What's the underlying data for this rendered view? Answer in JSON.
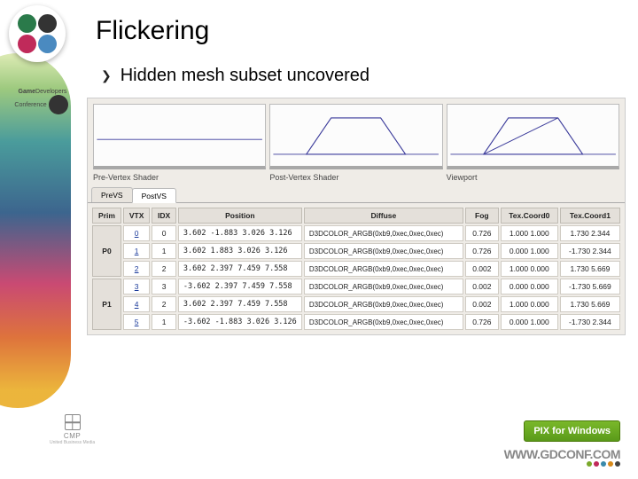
{
  "title": "Flickering",
  "bullet": "Hidden mesh subset uncovered",
  "viewports": [
    {
      "label": "Pre-Vertex Shader"
    },
    {
      "label": "Post-Vertex Shader"
    },
    {
      "label": "Viewport"
    }
  ],
  "tabs": [
    {
      "label": "PreVS",
      "active": false
    },
    {
      "label": "PostVS",
      "active": true
    }
  ],
  "columns": [
    "Prim",
    "VTX",
    "IDX",
    "Position",
    "Diffuse",
    "Fog",
    "Tex.Coord0",
    "Tex.Coord1"
  ],
  "prims": [
    {
      "name": "P0",
      "rows": [
        {
          "vtx": "0",
          "idx": "0",
          "pos": "3.602 -1.883 3.026 3.126",
          "diffuse": "D3DCOLOR_ARGB(0xb9,0xec,0xec,0xec)",
          "fog": "0.726",
          "tc0": "1.000 1.000",
          "tc1": "1.730 2.344"
        },
        {
          "vtx": "1",
          "idx": "1",
          "pos": "3.602 1.883 3.026 3.126",
          "diffuse": "D3DCOLOR_ARGB(0xb9,0xec,0xec,0xec)",
          "fog": "0.726",
          "tc0": "0.000 1.000",
          "tc1": "-1.730 2.344"
        },
        {
          "vtx": "2",
          "idx": "2",
          "pos": "3.602 2.397 7.459 7.558",
          "diffuse": "D3DCOLOR_ARGB(0xb9,0xec,0xec,0xec)",
          "fog": "0.002",
          "tc0": "1.000 0.000",
          "tc1": "1.730 5.669"
        }
      ]
    },
    {
      "name": "P1",
      "rows": [
        {
          "vtx": "3",
          "idx": "3",
          "pos": "-3.602 2.397 7.459 7.558",
          "diffuse": "D3DCOLOR_ARGB(0xb9,0xec,0xec,0xec)",
          "fog": "0.002",
          "tc0": "0.000 0.000",
          "tc1": "-1.730 5.669"
        },
        {
          "vtx": "4",
          "idx": "2",
          "pos": "3.602 2.397 7.459 7.558",
          "diffuse": "D3DCOLOR_ARGB(0xb9,0xec,0xec,0xec)",
          "fog": "0.002",
          "tc0": "1.000 0.000",
          "tc1": "1.730 5.669"
        },
        {
          "vtx": "5",
          "idx": "1",
          "pos": "-3.602 -1.883 3.026 3.126",
          "diffuse": "D3DCOLOR_ARGB(0xb9,0xec,0xec,0xec)",
          "fog": "0.726",
          "tc0": "0.000 1.000",
          "tc1": "-1.730 2.344"
        }
      ]
    }
  ],
  "footer": {
    "cmp": "CMP",
    "cmp_sub": "United Business Media",
    "pix": "PIX for Windows",
    "url": "WWW.GDCONF.COM"
  }
}
